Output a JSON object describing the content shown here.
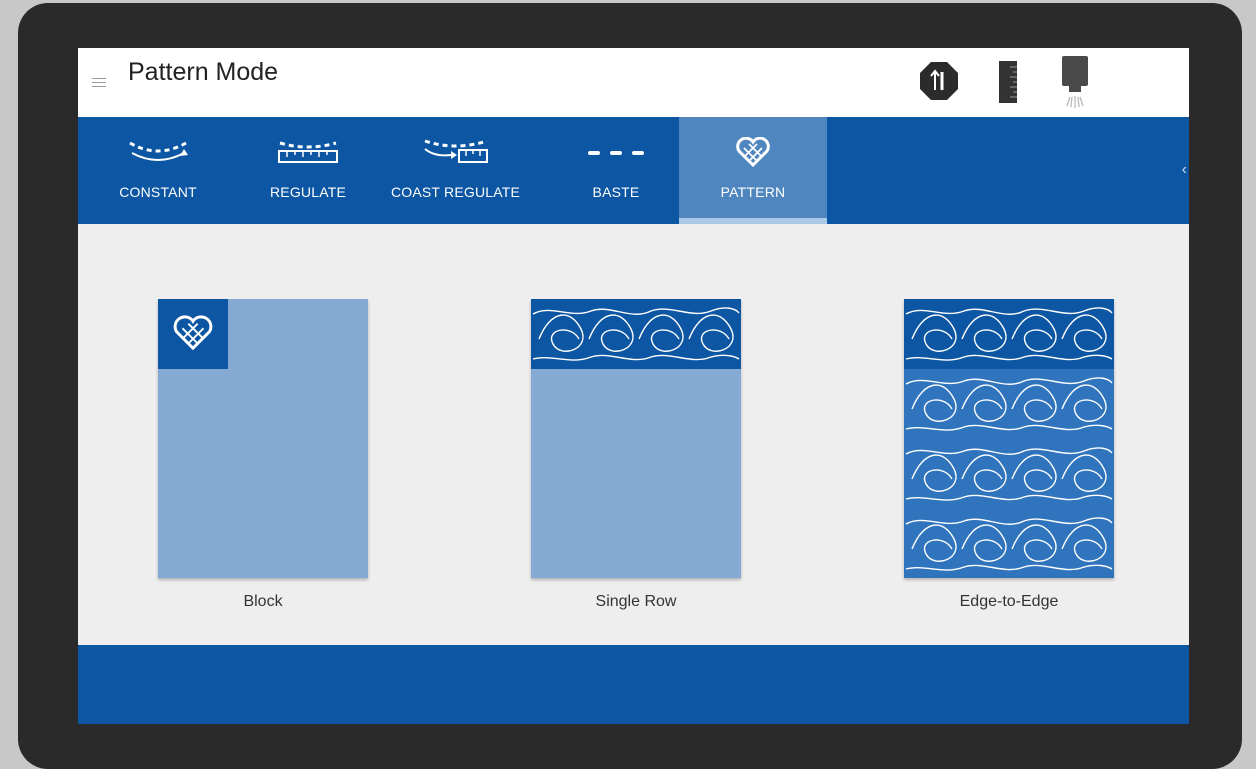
{
  "header": {
    "title": "Pattern Mode",
    "status_icons": [
      "needle-position-icon",
      "ruler-icon",
      "laser-light-icon"
    ]
  },
  "tabs": [
    {
      "label": "CONSTANT",
      "icon": "constant-stitch-icon",
      "active": false
    },
    {
      "label": "REGULATE",
      "icon": "regulate-stitch-icon",
      "active": false
    },
    {
      "label": "COAST REGULATE",
      "icon": "coast-regulate-icon",
      "active": false
    },
    {
      "label": "BASTE",
      "icon": "baste-stitch-icon",
      "active": false
    },
    {
      "label": "PATTERN",
      "icon": "heart-pattern-icon",
      "active": true
    }
  ],
  "cards": [
    {
      "name": "Block",
      "icon": "heart-pattern-icon"
    },
    {
      "name": "Single Row",
      "icon": "swirl-pattern-row"
    },
    {
      "name": "Edge-to-Edge",
      "icon": "swirl-pattern-grid"
    }
  ],
  "colors": {
    "primary_blue": "#0c56a3",
    "active_tab": "#4f86bf",
    "card_light": "#84aad3",
    "background": "#eeeeee"
  }
}
